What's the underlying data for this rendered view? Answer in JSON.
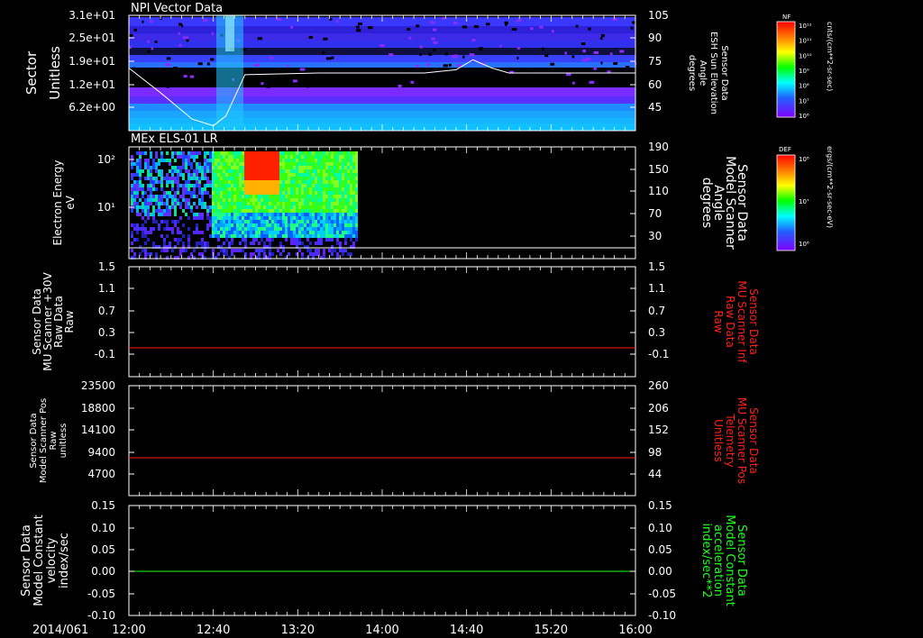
{
  "figure": {
    "date_label": "2014/061",
    "time_ticks": [
      "12:00",
      "12:40",
      "13:20",
      "14:00",
      "14:40",
      "15:20",
      "16:00"
    ]
  },
  "colors": {
    "background": "#000000",
    "axis": "#ffffff",
    "red": "#ff2020",
    "green": "#20ff20"
  },
  "panels": [
    {
      "id": "npi",
      "title": "NPI Vector Data",
      "left_label": [
        "Sector",
        "Unitless"
      ],
      "left_ticks": [
        "3.1e+01",
        "2.5e+01",
        "1.9e+01",
        "1.2e+01",
        "6.2e+00"
      ],
      "right_label": [
        "Sensor Data",
        "ESH Sun Elevation",
        "Angle",
        "degrees"
      ],
      "right_ticks": [
        "105",
        "90",
        "75",
        "60",
        "45"
      ],
      "colorbar": {
        "title": "NF",
        "ticks": [
          "10¹²",
          "10¹¹",
          "10¹⁰",
          "10⁹",
          "10⁸",
          "10⁷",
          "10⁶"
        ],
        "units": "cnts/(cm**2-sr-sec)"
      }
    },
    {
      "id": "els",
      "title": "MEx ELS-01 LR",
      "left_label": [
        "Electron Energy",
        "eV"
      ],
      "left_ticks": [
        "10²",
        "10¹"
      ],
      "right_label": [
        "Sensor Data",
        "Model Scanner",
        "Angle",
        "degrees"
      ],
      "right_ticks": [
        "190",
        "150",
        "110",
        "70",
        "30"
      ],
      "colorbar": {
        "title": "DEF",
        "ticks": [
          "10⁸",
          "10⁷",
          "10⁶"
        ],
        "units": "ergs/(cm**2-sr-sec-eV)"
      }
    },
    {
      "id": "scanner-raw",
      "left_label": [
        "Sensor Data",
        "MU Scanner +30V",
        "Raw Data",
        "Raw"
      ],
      "left_ticks": [
        "1.5",
        "1.1",
        "0.7",
        "0.3",
        "-0.1"
      ],
      "right_label": [
        "Sensor Data",
        "MU Scanner Inf",
        "Raw Data",
        "Raw"
      ],
      "right_ticks": [
        "1.5",
        "1.1",
        "0.7",
        "0.3",
        "-0.1"
      ],
      "line_color": "red"
    },
    {
      "id": "scanner-pos",
      "left_label": [
        "Sensor Data",
        "Model Scanner Pos",
        "Raw",
        "unitless"
      ],
      "left_ticks": [
        "23500",
        "18800",
        "14100",
        "9400",
        "4700"
      ],
      "right_label": [
        "Sensor Data",
        "MU Scanner Pos",
        "Telemetry",
        "Unitless"
      ],
      "right_ticks": [
        "260",
        "206",
        "152",
        "98",
        "44"
      ],
      "line_color": "red"
    },
    {
      "id": "model-const",
      "left_label": [
        "Sensor Data",
        "Model Constant",
        "velocity",
        "index/sec"
      ],
      "left_ticks": [
        "0.15",
        "0.10",
        "0.05",
        "0.00",
        "-0.05",
        "-0.10"
      ],
      "right_label": [
        "Sensor Data",
        "Model Constant",
        "acceleration",
        "index/sec**2"
      ],
      "right_ticks": [
        "0.15",
        "0.10",
        "0.05",
        "0.00",
        "-0.05",
        "-0.10"
      ],
      "line_color": "green"
    }
  ],
  "chart_data": [
    {
      "type": "heatmap",
      "title": "NPI Vector Data",
      "x_label": "",
      "x_range": [
        "12:00",
        "16:00"
      ],
      "y_label": "Sector Unitless",
      "y_ticks": [
        31,
        25,
        19,
        12,
        6.2
      ],
      "y2_label": "Sensor Data ESH Sun Elevation Angle degrees",
      "y2_ticks": [
        105,
        90,
        75,
        60,
        45
      ],
      "overlay_line": {
        "name": "ESH Sun Elevation Angle",
        "x": [
          "12:00",
          "12:15",
          "12:30",
          "12:40",
          "12:46",
          "12:55",
          "13:30",
          "14:00",
          "14:20",
          "14:35",
          "14:43",
          "14:52",
          "15:00",
          "15:30",
          "16:00"
        ],
        "y": [
          73,
          58,
          42,
          38,
          44,
          69,
          70,
          70,
          70,
          72,
          78,
          73,
          70,
          70,
          70
        ]
      }
    },
    {
      "type": "heatmap",
      "title": "MEx ELS-01 LR",
      "y_label": "Electron Energy eV",
      "y_scale": "log",
      "y_ticks": [
        "10²",
        "10¹"
      ],
      "y2_label": "Sensor Data Model Scanner Angle degrees",
      "y2_ticks": [
        190,
        150,
        110,
        70,
        30
      ],
      "data_extent": [
        "12:00",
        "13:55"
      ],
      "overlay_line": {
        "name": "Model Scanner Angle",
        "x": [
          "12:00",
          "16:00"
        ],
        "y": [
          12,
          12
        ]
      }
    },
    {
      "type": "line",
      "y_ticks": [
        1.5,
        1.1,
        0.7,
        0.3,
        -0.1
      ],
      "y2_ticks": [
        1.5,
        1.1,
        0.7,
        0.3,
        -0.1
      ],
      "ylim": [
        -0.3,
        1.5
      ],
      "series": [
        {
          "name": "MU Scanner Inf Raw Data",
          "x": [
            "12:00",
            "16:00"
          ],
          "values": [
            0,
            0
          ]
        }
      ]
    },
    {
      "type": "line",
      "y_ticks": [
        23500,
        18800,
        14100,
        9400,
        4700
      ],
      "y2_ticks": [
        260,
        206,
        152,
        98,
        44
      ],
      "ylim": [
        0,
        23500
      ],
      "y2lim": [
        -10,
        260
      ],
      "series": [
        {
          "name": "MU Scanner Pos Telemetry",
          "axis": "right",
          "x": [
            "12:00",
            "16:00"
          ],
          "values": [
            85,
            85
          ]
        }
      ]
    },
    {
      "type": "line",
      "y_ticks": [
        0.15,
        0.1,
        0.05,
        0.0,
        -0.05,
        -0.1
      ],
      "y2_ticks": [
        0.15,
        0.1,
        0.05,
        0.0,
        -0.05,
        -0.1
      ],
      "ylim": [
        -0.1,
        0.15
      ],
      "series": [
        {
          "name": "Model Constant acceleration",
          "x": [
            "12:00",
            "16:00"
          ],
          "values": [
            0,
            0
          ]
        }
      ]
    }
  ]
}
